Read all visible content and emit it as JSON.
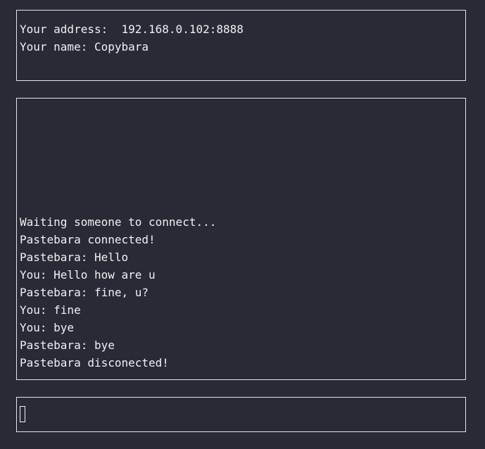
{
  "info": {
    "address_line": "Your address:  192.168.0.102:8888",
    "name_line": "Your name: Copybara"
  },
  "chat": {
    "messages": [
      "Waiting someone to connect...",
      "Pastebara connected!",
      "Pastebara: Hello",
      "You: Hello how are u",
      "Pastebara: fine, u?",
      "You: fine",
      "You: bye",
      "Pastebara: bye",
      "Pastebara disconected!"
    ]
  },
  "input": {
    "value": ""
  }
}
